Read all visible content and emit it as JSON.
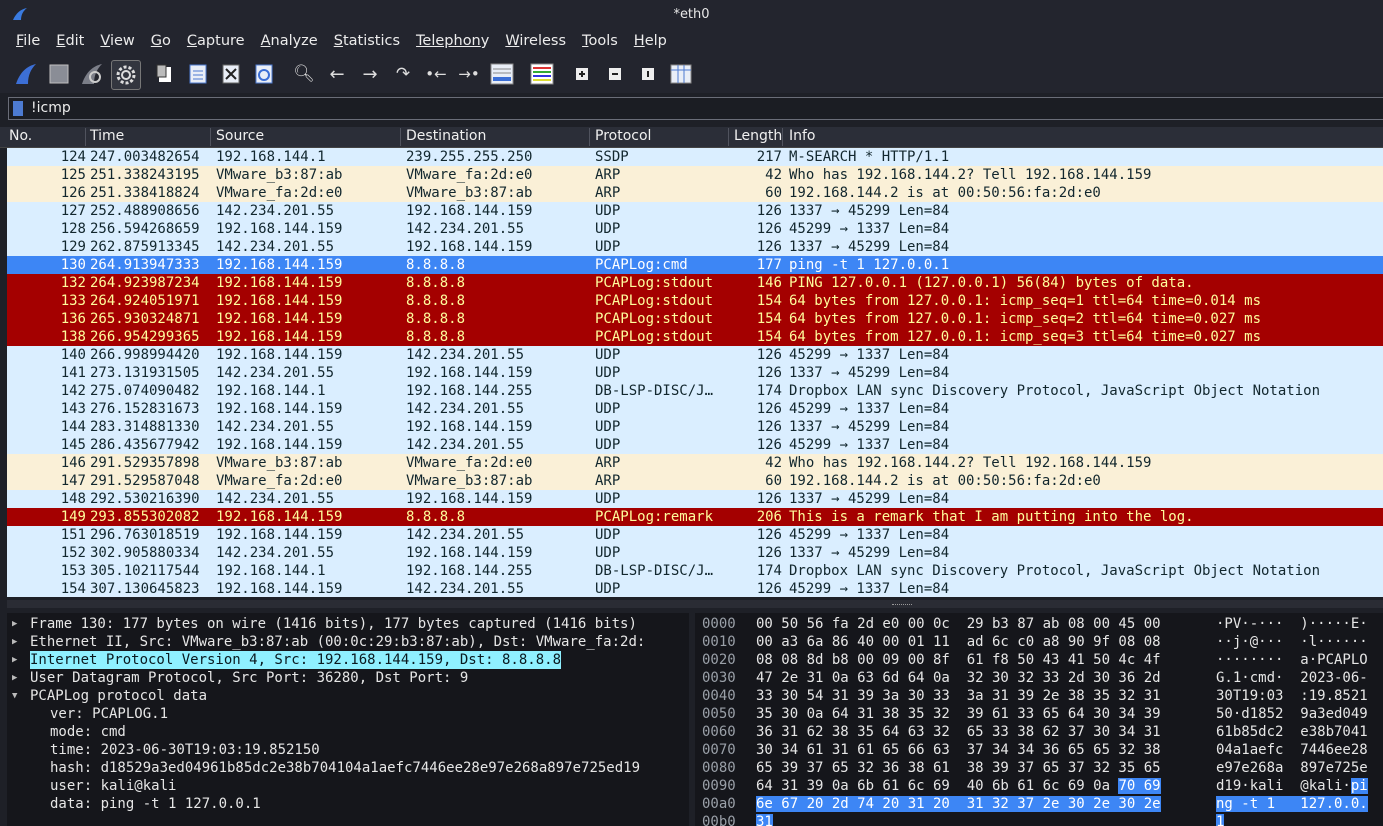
{
  "window": {
    "title": "*eth0"
  },
  "menu": [
    {
      "label": "File",
      "u": "F",
      "rest": "ile"
    },
    {
      "label": "Edit",
      "u": "E",
      "rest": "dit"
    },
    {
      "label": "View",
      "u": "V",
      "rest": "iew"
    },
    {
      "label": "Go",
      "u": "G",
      "rest": "o"
    },
    {
      "label": "Capture",
      "u": "C",
      "rest": "apture"
    },
    {
      "label": "Analyze",
      "u": "A",
      "rest": "nalyze"
    },
    {
      "label": "Statistics",
      "u": "S",
      "rest": "tatistics"
    },
    {
      "label": "Telephony",
      "u": "Telephon",
      "rest": "y"
    },
    {
      "label": "Wireless",
      "u": "W",
      "rest": "ireless"
    },
    {
      "label": "Tools",
      "u": "T",
      "rest": "ools"
    },
    {
      "label": "Help",
      "u": "H",
      "rest": "elp"
    }
  ],
  "filter": {
    "value": "!icmp"
  },
  "columns": {
    "no": "No.",
    "time": "Time",
    "source": "Source",
    "destination": "Destination",
    "protocol": "Protocol",
    "length": "Length",
    "info": "Info"
  },
  "packets": [
    {
      "no": "124",
      "time": "247.003482654",
      "src": "192.168.144.1",
      "dst": "239.255.255.250",
      "proto": "SSDP",
      "len": "217",
      "info": "M-SEARCH * HTTP/1.1",
      "style": "udp"
    },
    {
      "no": "125",
      "time": "251.338243195",
      "src": "VMware_b3:87:ab",
      "dst": "VMware_fa:2d:e0",
      "proto": "ARP",
      "len": "42",
      "info": "Who has 192.168.144.2? Tell 192.168.144.159",
      "style": "arp"
    },
    {
      "no": "126",
      "time": "251.338418824",
      "src": "VMware_fa:2d:e0",
      "dst": "VMware_b3:87:ab",
      "proto": "ARP",
      "len": "60",
      "info": "192.168.144.2 is at 00:50:56:fa:2d:e0",
      "style": "arp"
    },
    {
      "no": "127",
      "time": "252.488908656",
      "src": "142.234.201.55",
      "dst": "192.168.144.159",
      "proto": "UDP",
      "len": "126",
      "info": "1337 → 45299 Len=84",
      "style": "udp"
    },
    {
      "no": "128",
      "time": "256.594268659",
      "src": "192.168.144.159",
      "dst": "142.234.201.55",
      "proto": "UDP",
      "len": "126",
      "info": "45299 → 1337 Len=84",
      "style": "udp"
    },
    {
      "no": "129",
      "time": "262.875913345",
      "src": "142.234.201.55",
      "dst": "192.168.144.159",
      "proto": "UDP",
      "len": "126",
      "info": "1337 → 45299 Len=84",
      "style": "udp"
    },
    {
      "no": "130",
      "time": "264.913947333",
      "src": "192.168.144.159",
      "dst": "8.8.8.8",
      "proto": "PCAPLog:cmd",
      "len": "177",
      "info": "ping -t 1 127.0.0.1",
      "style": "sel"
    },
    {
      "no": "132",
      "time": "264.923987234",
      "src": "192.168.144.159",
      "dst": "8.8.8.8",
      "proto": "PCAPLog:stdout",
      "len": "146",
      "info": "PING 127.0.0.1 (127.0.0.1) 56(84) bytes of data.",
      "style": "red"
    },
    {
      "no": "133",
      "time": "264.924051971",
      "src": "192.168.144.159",
      "dst": "8.8.8.8",
      "proto": "PCAPLog:stdout",
      "len": "154",
      "info": "64 bytes from 127.0.0.1: icmp_seq=1 ttl=64 time=0.014 ms",
      "style": "red"
    },
    {
      "no": "136",
      "time": "265.930324871",
      "src": "192.168.144.159",
      "dst": "8.8.8.8",
      "proto": "PCAPLog:stdout",
      "len": "154",
      "info": "64 bytes from 127.0.0.1: icmp_seq=2 ttl=64 time=0.027 ms",
      "style": "red"
    },
    {
      "no": "138",
      "time": "266.954299365",
      "src": "192.168.144.159",
      "dst": "8.8.8.8",
      "proto": "PCAPLog:stdout",
      "len": "154",
      "info": "64 bytes from 127.0.0.1: icmp_seq=3 ttl=64 time=0.027 ms",
      "style": "red"
    },
    {
      "no": "140",
      "time": "266.998994420",
      "src": "192.168.144.159",
      "dst": "142.234.201.55",
      "proto": "UDP",
      "len": "126",
      "info": "45299 → 1337 Len=84",
      "style": "udp"
    },
    {
      "no": "141",
      "time": "273.131931505",
      "src": "142.234.201.55",
      "dst": "192.168.144.159",
      "proto": "UDP",
      "len": "126",
      "info": "1337 → 45299 Len=84",
      "style": "udp"
    },
    {
      "no": "142",
      "time": "275.074090482",
      "src": "192.168.144.1",
      "dst": "192.168.144.255",
      "proto": "DB-LSP-DISC/J…",
      "len": "174",
      "info": "Dropbox LAN sync Discovery Protocol, JavaScript Object Notation",
      "style": "udp"
    },
    {
      "no": "143",
      "time": "276.152831673",
      "src": "192.168.144.159",
      "dst": "142.234.201.55",
      "proto": "UDP",
      "len": "126",
      "info": "45299 → 1337 Len=84",
      "style": "udp"
    },
    {
      "no": "144",
      "time": "283.314881330",
      "src": "142.234.201.55",
      "dst": "192.168.144.159",
      "proto": "UDP",
      "len": "126",
      "info": "1337 → 45299 Len=84",
      "style": "udp"
    },
    {
      "no": "145",
      "time": "286.435677942",
      "src": "192.168.144.159",
      "dst": "142.234.201.55",
      "proto": "UDP",
      "len": "126",
      "info": "45299 → 1337 Len=84",
      "style": "udp"
    },
    {
      "no": "146",
      "time": "291.529357898",
      "src": "VMware_b3:87:ab",
      "dst": "VMware_fa:2d:e0",
      "proto": "ARP",
      "len": "42",
      "info": "Who has 192.168.144.2? Tell 192.168.144.159",
      "style": "arp"
    },
    {
      "no": "147",
      "time": "291.529587048",
      "src": "VMware_fa:2d:e0",
      "dst": "VMware_b3:87:ab",
      "proto": "ARP",
      "len": "60",
      "info": "192.168.144.2 is at 00:50:56:fa:2d:e0",
      "style": "arp"
    },
    {
      "no": "148",
      "time": "292.530216390",
      "src": "142.234.201.55",
      "dst": "192.168.144.159",
      "proto": "UDP",
      "len": "126",
      "info": "1337 → 45299 Len=84",
      "style": "udp"
    },
    {
      "no": "149",
      "time": "293.855302082",
      "src": "192.168.144.159",
      "dst": "8.8.8.8",
      "proto": "PCAPLog:remark",
      "len": "206",
      "info": "This is a remark that I am putting into the log.",
      "style": "red"
    },
    {
      "no": "151",
      "time": "296.763018519",
      "src": "192.168.144.159",
      "dst": "142.234.201.55",
      "proto": "UDP",
      "len": "126",
      "info": "45299 → 1337 Len=84",
      "style": "udp"
    },
    {
      "no": "152",
      "time": "302.905880334",
      "src": "142.234.201.55",
      "dst": "192.168.144.159",
      "proto": "UDP",
      "len": "126",
      "info": "1337 → 45299 Len=84",
      "style": "udp"
    },
    {
      "no": "153",
      "time": "305.102117544",
      "src": "192.168.144.1",
      "dst": "192.168.144.255",
      "proto": "DB-LSP-DISC/J…",
      "len": "174",
      "info": "Dropbox LAN sync Discovery Protocol, JavaScript Object Notation",
      "style": "udp"
    },
    {
      "no": "154",
      "time": "307.130645823",
      "src": "192.168.144.159",
      "dst": "142.234.201.55",
      "proto": "UDP",
      "len": "126",
      "info": "45299 → 1337 Len=84",
      "style": "udp"
    }
  ],
  "details": [
    {
      "text": "Frame 130: 177 bytes on wire (1416 bits), 177 bytes captured (1416 bits)",
      "expander": "right",
      "level": 0,
      "highlight": false
    },
    {
      "text": "Ethernet II, Src: VMware_b3:87:ab (00:0c:29:b3:87:ab), Dst: VMware_fa:2d:",
      "expander": "right",
      "level": 0,
      "highlight": false
    },
    {
      "text": "Internet Protocol Version 4, Src: 192.168.144.159, Dst: 8.8.8.8",
      "expander": "right",
      "level": 0,
      "highlight": true
    },
    {
      "text": "User Datagram Protocol, Src Port: 36280, Dst Port: 9",
      "expander": "right",
      "level": 0,
      "highlight": false
    },
    {
      "text": "PCAPLog protocol data",
      "expander": "down",
      "level": 0,
      "highlight": false
    },
    {
      "text": "ver: PCAPLOG.1",
      "expander": "none",
      "level": 1,
      "highlight": false
    },
    {
      "text": "mode: cmd",
      "expander": "none",
      "level": 1,
      "highlight": false
    },
    {
      "text": "time: 2023-06-30T19:03:19.852150",
      "expander": "none",
      "level": 1,
      "highlight": false
    },
    {
      "text": "hash: d18529a3ed04961b85dc2e38b704104a1aefc7446ee28e97e268a897e725ed19",
      "expander": "none",
      "level": 1,
      "highlight": false
    },
    {
      "text": "user: kali@kali",
      "expander": "none",
      "level": 1,
      "highlight": false
    },
    {
      "text": "data: ping -t 1 127.0.0.1",
      "expander": "none",
      "level": 1,
      "highlight": false
    }
  ],
  "hex": [
    {
      "off": "0000",
      "bytes": "00 50 56 fa 2d e0 00 0c  29 b3 87 ab 08 00 45 00",
      "ascii": "·PV·-···  )·····E·",
      "sel_bytes": "",
      "sel_ascii": ""
    },
    {
      "off": "0010",
      "bytes": "00 a3 6a 86 40 00 01 11  ad 6c c0 a8 90 9f 08 08",
      "ascii": "··j·@···  ·l······",
      "sel_bytes": "",
      "sel_ascii": ""
    },
    {
      "off": "0020",
      "bytes": "08 08 8d b8 00 09 00 8f  61 f8 50 43 41 50 4c 4f",
      "ascii": "········  a·PCAPLO",
      "sel_bytes": "",
      "sel_ascii": ""
    },
    {
      "off": "0030",
      "bytes": "47 2e 31 0a 63 6d 64 0a  32 30 32 33 2d 30 36 2d",
      "ascii": "G.1·cmd·  2023-06-",
      "sel_bytes": "",
      "sel_ascii": ""
    },
    {
      "off": "0040",
      "bytes": "33 30 54 31 39 3a 30 33  3a 31 39 2e 38 35 32 31",
      "ascii": "30T19:03  :19.8521",
      "sel_bytes": "",
      "sel_ascii": ""
    },
    {
      "off": "0050",
      "bytes": "35 30 0a 64 31 38 35 32  39 61 33 65 64 30 34 39",
      "ascii": "50·d1852  9a3ed049",
      "sel_bytes": "",
      "sel_ascii": ""
    },
    {
      "off": "0060",
      "bytes": "36 31 62 38 35 64 63 32  65 33 38 62 37 30 34 31",
      "ascii": "61b85dc2  e38b7041",
      "sel_bytes": "",
      "sel_ascii": ""
    },
    {
      "off": "0070",
      "bytes": "30 34 61 31 61 65 66 63  37 34 34 36 65 65 32 38",
      "ascii": "04a1aefc  7446ee28",
      "sel_bytes": "",
      "sel_ascii": ""
    },
    {
      "off": "0080",
      "bytes": "65 39 37 65 32 36 38 61  38 39 37 65 37 32 35 65",
      "ascii": "e97e268a  897e725e",
      "sel_bytes": "",
      "sel_ascii": ""
    },
    {
      "off": "0090",
      "bytes": "64 31 39 0a 6b 61 6c 69  40 6b 61 6c 69 0a ",
      "ascii": "d19·kali  @kali·",
      "sel_bytes": "70 69",
      "sel_ascii": "pi"
    },
    {
      "off": "00a0",
      "bytes": "",
      "ascii": "",
      "sel_bytes": "6e 67 20 2d 74 20 31 20  31 32 37 2e 30 2e 30 2e",
      "sel_ascii": "ng -t 1   127.0.0."
    },
    {
      "off": "00b0",
      "bytes": "",
      "ascii": "",
      "sel_bytes": "31",
      "sel_ascii": "1"
    }
  ]
}
